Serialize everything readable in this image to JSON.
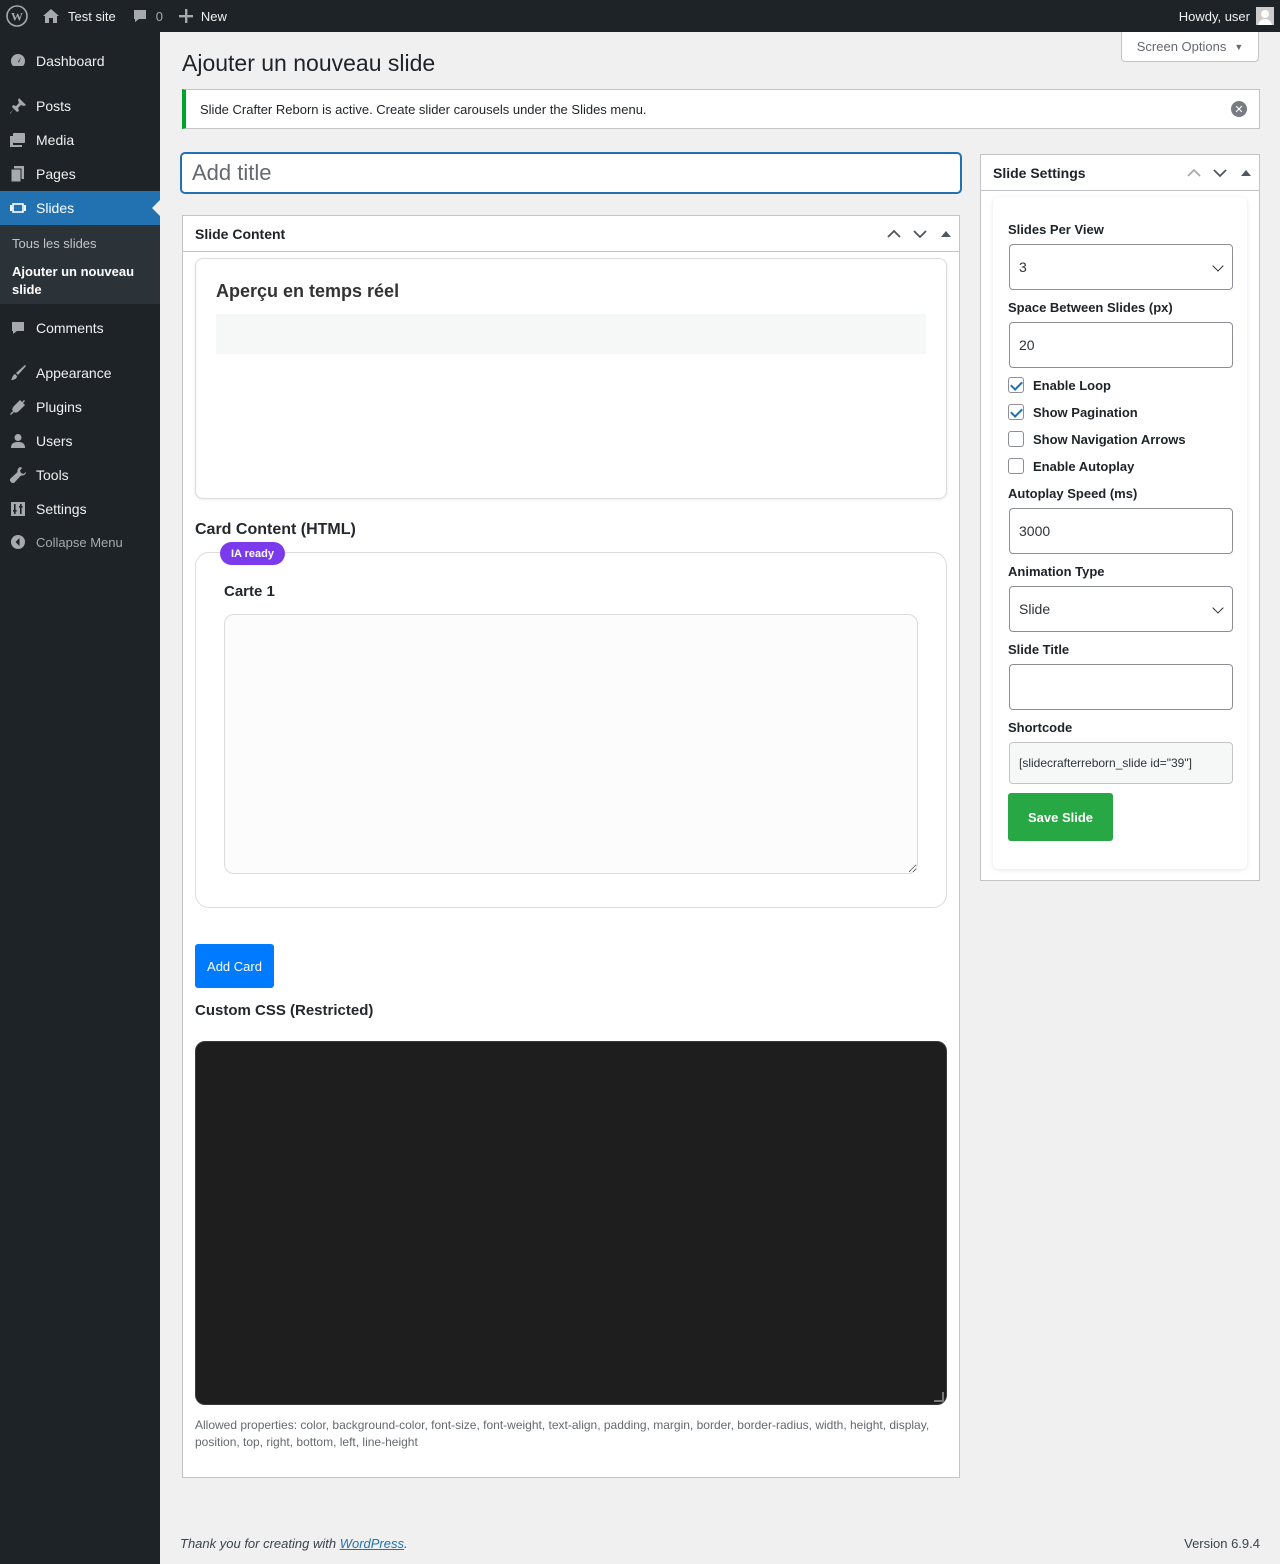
{
  "adminbar": {
    "site_name": "Test site",
    "comments_count": "0",
    "new_label": "New",
    "howdy": "Howdy, user"
  },
  "sidebar": {
    "items": [
      {
        "label": "Dashboard",
        "icon": "dashboard-icon"
      },
      {
        "label": "Posts",
        "icon": "pin-icon"
      },
      {
        "label": "Media",
        "icon": "media-icon"
      },
      {
        "label": "Pages",
        "icon": "pages-icon"
      },
      {
        "label": "Slides",
        "icon": "slides-icon"
      },
      {
        "label": "Comments",
        "icon": "comment-icon"
      },
      {
        "label": "Appearance",
        "icon": "brush-icon"
      },
      {
        "label": "Plugins",
        "icon": "plugin-icon"
      },
      {
        "label": "Users",
        "icon": "user-icon"
      },
      {
        "label": "Tools",
        "icon": "wrench-icon"
      },
      {
        "label": "Settings",
        "icon": "settings-icon"
      }
    ],
    "submenu": [
      "Tous les slides",
      "Ajouter un nouveau slide"
    ],
    "collapse": "Collapse Menu"
  },
  "screen_options": "Screen Options",
  "page_title": "Ajouter un nouveau slide",
  "notice": "Slide Crafter Reborn is active. Create slider carousels under the Slides menu.",
  "title_placeholder": "Add title",
  "slide_content": {
    "header": "Slide Content",
    "preview_title": "Aperçu en temps réel",
    "card_section_label": "Card Content (HTML)",
    "badge": "IA ready",
    "card_title": "Carte 1",
    "add_card": "Add Card",
    "css_label": "Custom CSS (Restricted)",
    "allowed": "Allowed properties: color, background-color, font-size, font-weight, text-align, padding, margin, border, border-radius, width, height, display, position, top, right, bottom, left, line-height"
  },
  "settings": {
    "header": "Slide Settings",
    "slides_per_view_label": "Slides Per View",
    "slides_per_view": "3",
    "space_label": "Space Between Slides (px)",
    "space_value": "20",
    "enable_loop": "Enable Loop",
    "show_pagination": "Show Pagination",
    "show_arrows": "Show Navigation Arrows",
    "enable_autoplay": "Enable Autoplay",
    "autoplay_speed_label": "Autoplay Speed (ms)",
    "autoplay_speed": "3000",
    "animation_label": "Animation Type",
    "animation_value": "Slide",
    "slide_title_label": "Slide Title",
    "slide_title_value": "",
    "shortcode_label": "Shortcode",
    "shortcode": "[slidecrafterreborn_slide id=\"39\"]",
    "save": "Save Slide"
  },
  "footer": {
    "thanks_prefix": "Thank you for creating with ",
    "thanks_link": "WordPress",
    "thanks_suffix": ".",
    "version": "Version 6.9.4"
  }
}
